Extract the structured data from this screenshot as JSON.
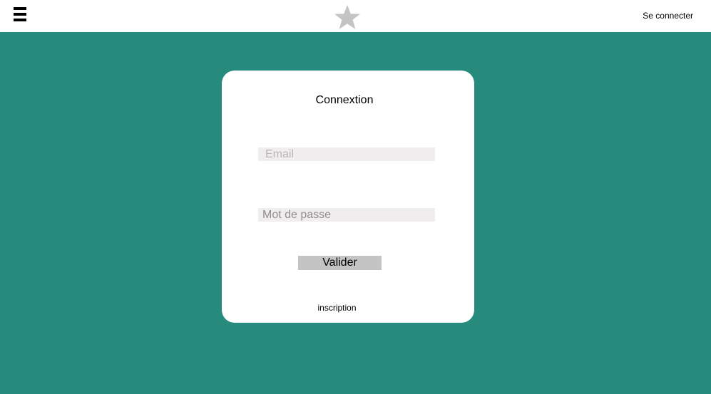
{
  "header": {
    "menu_icon": "hamburger-menu-icon",
    "logo_icon": "star-icon",
    "logo_color": "#c4c4c4",
    "signin_label": "Se connecter"
  },
  "login_card": {
    "title": "Connextion",
    "email_placeholder": "Email",
    "password_placeholder": "Mot de passe",
    "submit_label": "Valider",
    "register_label": "inscription"
  },
  "colors": {
    "background": "#268b7d",
    "card": "#ffffff",
    "input_background": "#efeded",
    "button_background": "#c4c4c4"
  }
}
